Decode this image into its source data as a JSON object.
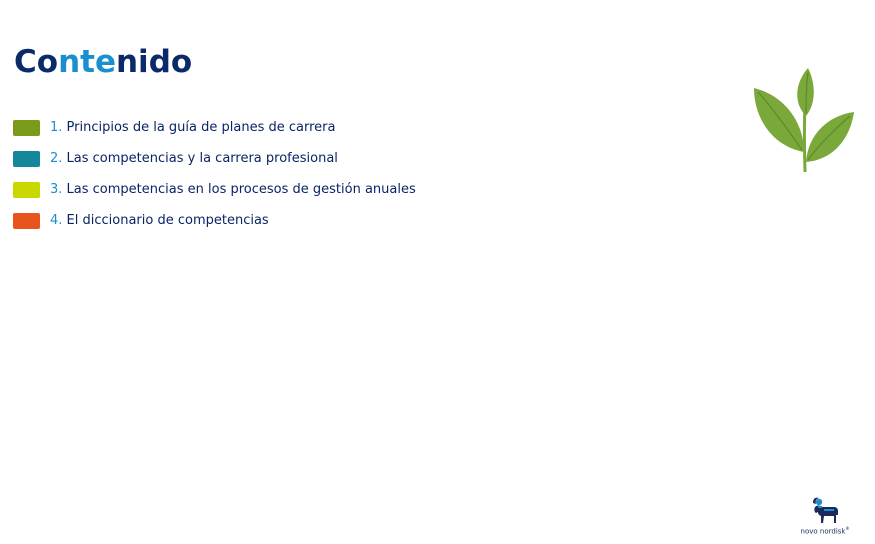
{
  "slide": {
    "title_parts": [
      "Co",
      "nte",
      "ni",
      "do"
    ],
    "items": [
      {
        "number": "1.",
        "text": "Principios de la guía de planes de carrera",
        "color": "#7a9a1a"
      },
      {
        "number": "2.",
        "text": "Las competencias y la carrera profesional",
        "color": "#14889a"
      },
      {
        "number": "3.",
        "text": "Las competencias en los procesos de gestión anuales",
        "color": "#c9d800"
      },
      {
        "number": "4.",
        "text": "El diccionario de competencias",
        "color": "#e9531c"
      }
    ]
  },
  "decor": {
    "plant_icon": "sprout-icon",
    "plant_color": "#7aa83a"
  },
  "logo": {
    "icon": "apis-bull-icon",
    "text": "novo nordisk",
    "registered": "®"
  }
}
